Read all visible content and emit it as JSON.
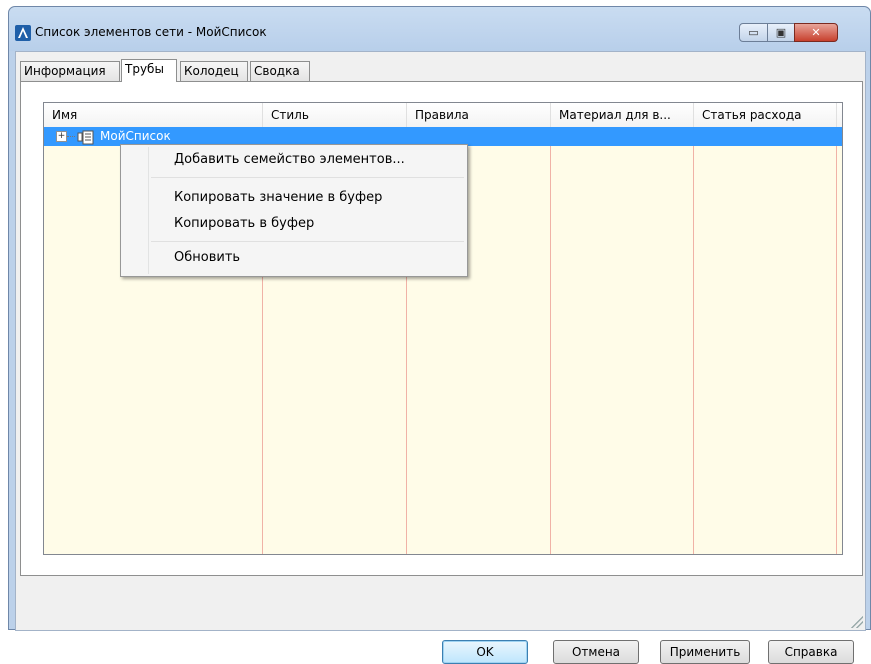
{
  "window": {
    "title": "Список элементов сети - МойСписок",
    "min_glyph": "▭",
    "max_glyph": "▣",
    "close_glyph": "✕"
  },
  "tabs": [
    {
      "label": "Информация",
      "active": false
    },
    {
      "label": "Трубы",
      "active": true
    },
    {
      "label": "Колодец",
      "active": false
    },
    {
      "label": "Сводка",
      "active": false
    }
  ],
  "grid": {
    "columns": [
      "Имя",
      "Стиль",
      "Правила",
      "Материал для в...",
      "Статья расхода"
    ],
    "tree_root": {
      "label": "МойСписок",
      "expander": "+",
      "icon": "network-list-icon",
      "selected": true
    }
  },
  "context_menu": {
    "items": [
      {
        "label": "Добавить семейство элементов..."
      },
      {
        "label": "Копировать значение в буфер"
      },
      {
        "label": "Копировать в буфер"
      },
      {
        "label": "Обновить"
      }
    ]
  },
  "buttons": {
    "ok": "OK",
    "cancel": "Отмена",
    "apply": "Применить",
    "help": "Справка"
  },
  "colors": {
    "selection": "#3399ff",
    "grid_background": "#fffce8",
    "column_lines": "#f0b2a6",
    "titlebar": "#c9dcf1",
    "close_button": "#c7402d"
  }
}
